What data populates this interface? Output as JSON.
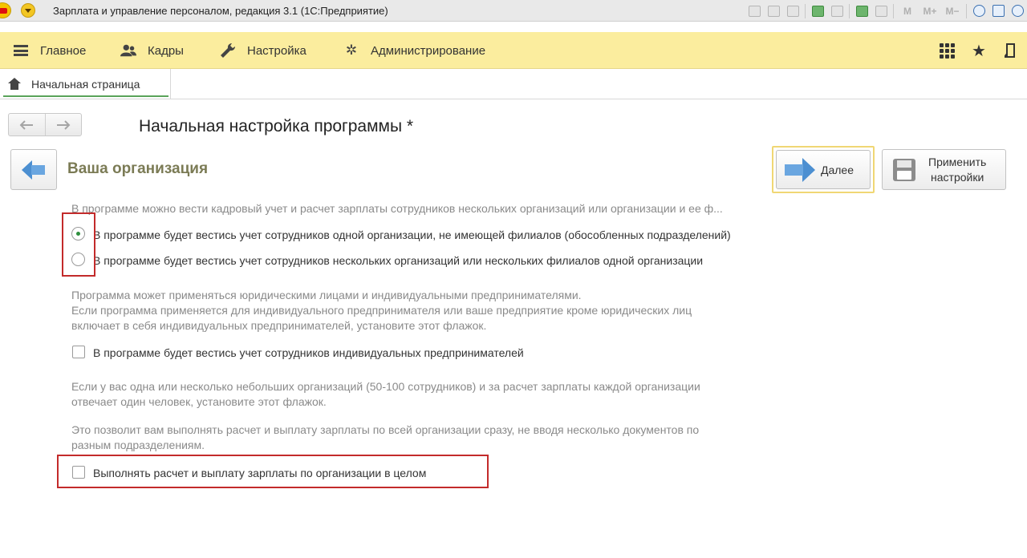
{
  "window": {
    "title": "Зарплата и управление персоналом, редакция 3.1  (1С:Предприятие)",
    "toolbar_icons": [
      "save-icon",
      "print-icon",
      "preview-icon",
      "attach-icon",
      "document-icon",
      "calculator-icon",
      "calendar-icon",
      "zoom-icon",
      "panel-icon",
      "info-icon"
    ],
    "memory_labels": [
      "M",
      "M+",
      "M−"
    ]
  },
  "sections": [
    {
      "label": "Главное",
      "icon": "menu-icon"
    },
    {
      "label": "Кадры",
      "icon": "users-icon"
    },
    {
      "label": "Настройка",
      "icon": "wrench-icon"
    },
    {
      "label": "Администрирование",
      "icon": "gear-icon"
    }
  ],
  "tabs": [
    {
      "label": "Начальная страница",
      "icon": "home-icon"
    }
  ],
  "form": {
    "title": "Начальная настройка программы *",
    "section_title": "Ваша организация",
    "next_label": "Далее",
    "apply_line1": "Применить",
    "apply_line2": "настройки"
  },
  "content": {
    "intro": "В программе можно вести кадровый учет и расчет зарплаты сотрудников нескольких организаций или организации и ее ф...",
    "radio_options": [
      {
        "label": "В программе будет вестись учет сотрудников одной организации, не имеющей филиалов (обособленных подразделений)",
        "selected": true
      },
      {
        "label": "В программе будет вестись учет сотрудников нескольких организаций или нескольких филиалов одной организации",
        "selected": false
      }
    ],
    "ip_hint": [
      "Программа может применяться юридическими лицами и индивидуальными предпринимателями.",
      "Если программа применяется для индивидуального предпринимателя или ваше предприятие кроме юридических лиц",
      "включает в себя индивидуальных предпринимателей, установите этот флажок."
    ],
    "ip_checkbox": {
      "label": "В программе будет вестись учет сотрудников индивидуальных предпринимателей",
      "checked": false
    },
    "small_org_hint": [
      "Если у вас одна или несколько небольших организаций (50-100 сотрудников) и за расчет зарплаты каждой организации",
      "отвечает один человек, установите этот флажок."
    ],
    "whole_org_hint": [
      "Это позволит вам выполнять расчет и выплату зарплаты по всей организации сразу, не вводя несколько документов по",
      "разным подразделениям."
    ],
    "whole_org_checkbox": {
      "label": "Выполнять расчет и выплату зарплаты по организации в целом",
      "checked": false
    }
  },
  "colors": {
    "section_panel": "#fbed9e",
    "section_title": "#7b7b55",
    "highlight": "#c32b2b",
    "radio_selected": "#2e8f3e"
  }
}
